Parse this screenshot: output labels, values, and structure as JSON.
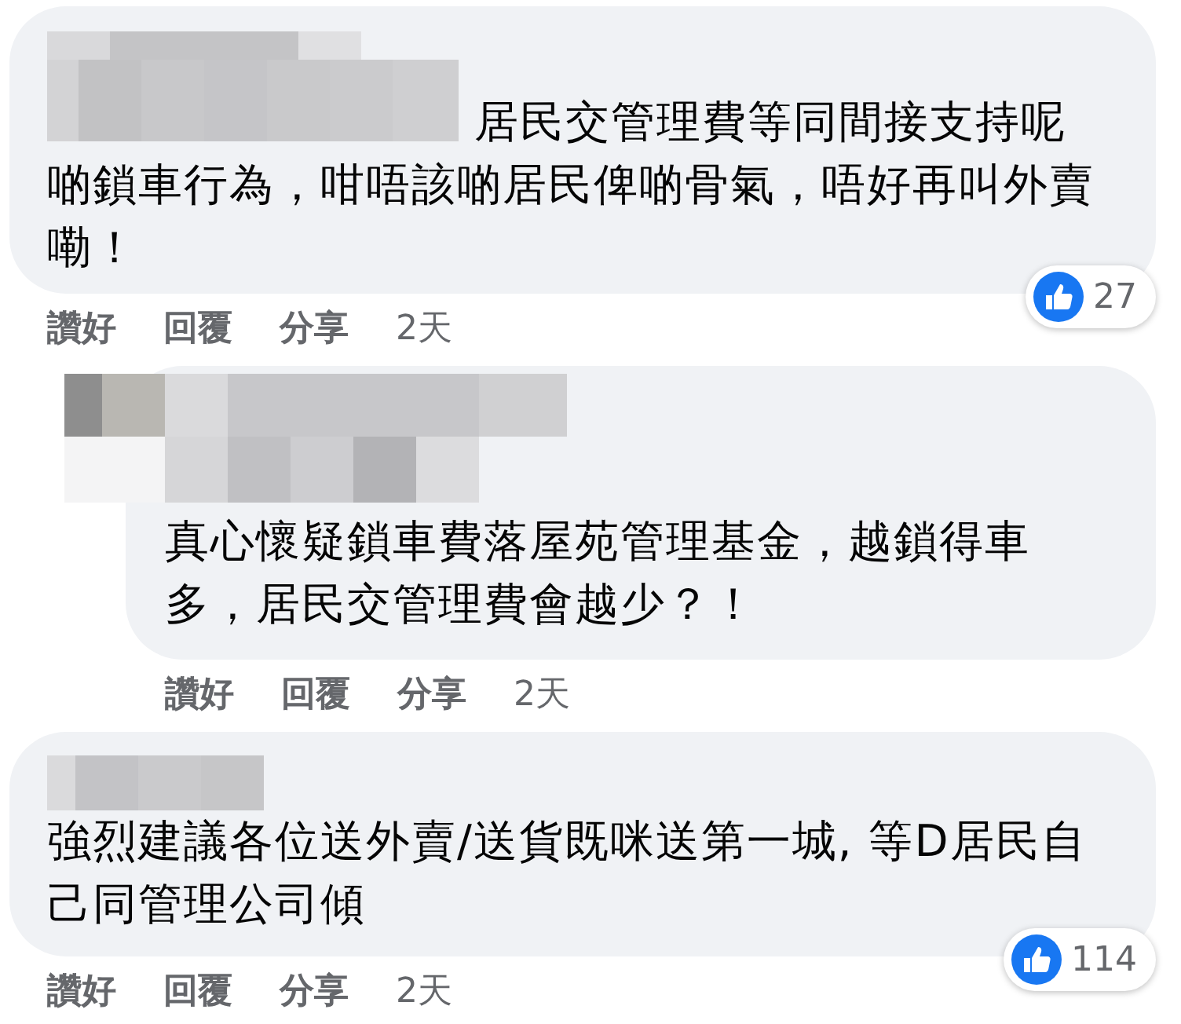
{
  "comments": [
    {
      "author_redacted": true,
      "reply": false,
      "text": "居民交管理費等同間接支持呢啲鎖車行為，咁唔該啲居民俾啲骨氣，唔好再叫外賣嘞！",
      "reactions": "27",
      "actions": [
        "讚好",
        "回覆",
        "分享"
      ],
      "time": "2天"
    },
    {
      "author_redacted": true,
      "reply": true,
      "text": "真心懷疑鎖車費落屋苑管理基金，越鎖得車多，居民交管理費會越少？！",
      "actions": [
        "讚好",
        "回覆",
        "分享"
      ],
      "time": "2天"
    },
    {
      "author_redacted": true,
      "reply": false,
      "text": "強烈建議各位送外賣/送貨既咪送第一城, 等D居民自己同管理公司傾",
      "reactions": "114",
      "actions": [
        "讚好",
        "回覆",
        "分享"
      ],
      "time": "2天"
    }
  ]
}
